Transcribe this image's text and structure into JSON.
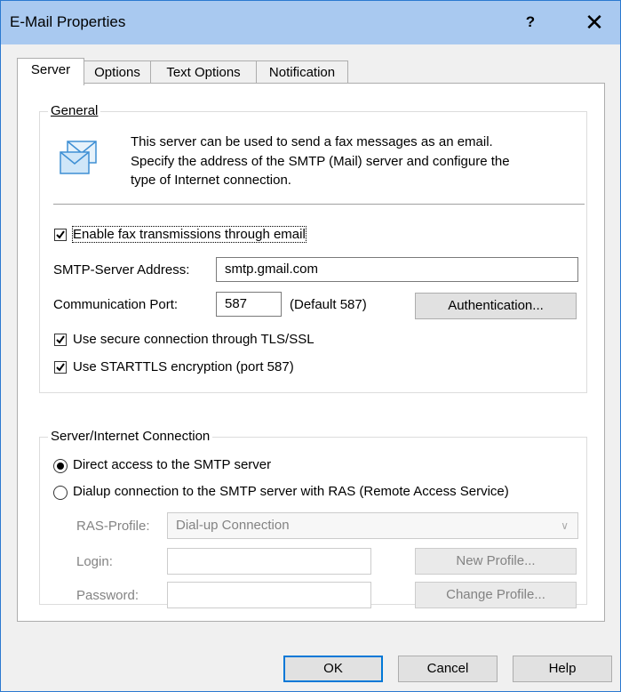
{
  "window": {
    "title": "E-Mail Properties",
    "help_glyph": "?",
    "close_glyph": "✕"
  },
  "tabs": [
    {
      "label": "Server",
      "active": true
    },
    {
      "label": "Options",
      "active": false
    },
    {
      "label": "Text Options",
      "active": false
    },
    {
      "label": "Notification",
      "active": false
    }
  ],
  "general": {
    "legend": "General",
    "icon": "email-envelope-icon",
    "description_line1": "This server can be used to send a fax messages as an email.",
    "description_line2": "Specify the address of the SMTP (Mail) server and configure the",
    "description_line3": "type of Internet connection.",
    "enable_label": "Enable fax transmissions through email",
    "enable_checked": true,
    "smtp_label": "SMTP-Server Address:",
    "smtp_value": "smtp.gmail.com",
    "port_label": "Communication Port:",
    "port_value": "587",
    "port_default": "(Default 587)",
    "auth_button": "Authentication...",
    "tls_label": "Use secure connection through TLS/SSL",
    "tls_checked": true,
    "starttls_label": "Use STARTTLS encryption (port 587)",
    "starttls_checked": true
  },
  "connection": {
    "legend": "Server/Internet Connection",
    "direct_label": "Direct access to the SMTP server",
    "direct_selected": true,
    "dialup_label": "Dialup connection to the SMTP server with RAS (Remote Access Service)",
    "dialup_selected": false,
    "ras_label": "RAS-Profile:",
    "ras_value": "Dial-up Connection",
    "login_label": "Login:",
    "login_value": "",
    "password_label": "Password:",
    "password_value": "",
    "new_profile_button": "New Profile...",
    "change_profile_button": "Change Profile..."
  },
  "footer": {
    "ok": "OK",
    "cancel": "Cancel",
    "help": "Help"
  },
  "colors": {
    "titlebar": "#a9c9f0",
    "accent": "#0078d7"
  }
}
